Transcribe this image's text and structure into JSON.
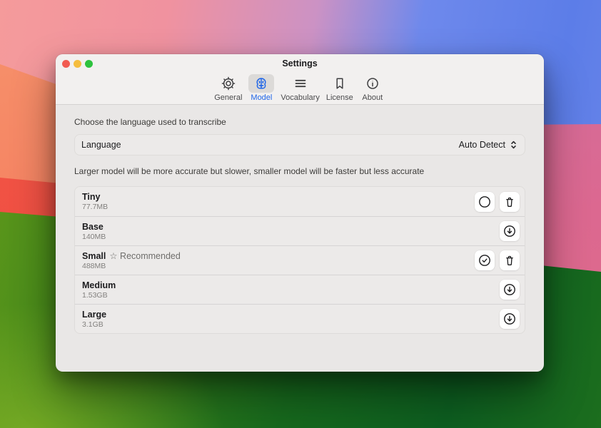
{
  "window": {
    "title": "Settings"
  },
  "traffic_lights": {
    "close": "#f15b51",
    "minimize": "#f5bd3e",
    "zoom": "#2ec23e"
  },
  "toolbar": {
    "accent": "#2167e8",
    "items": [
      {
        "label": "General"
      },
      {
        "label": "Model"
      },
      {
        "label": "Vocabulary"
      },
      {
        "label": "License"
      },
      {
        "label": "About"
      }
    ],
    "selected": "Model"
  },
  "language_section": {
    "description": "Choose the language used to transcribe",
    "label": "Language",
    "value": "Auto Detect"
  },
  "model_section": {
    "description": "Larger model will be more accurate but slower, smaller model will be faster but less accurate",
    "models": [
      {
        "name": "Tiny",
        "size": "77.7MB",
        "badge": ""
      },
      {
        "name": "Base",
        "size": "140MB",
        "badge": ""
      },
      {
        "name": "Small",
        "size": "488MB",
        "badge": "☆ Recommended"
      },
      {
        "name": "Medium",
        "size": "1.53GB",
        "badge": ""
      },
      {
        "name": "Large",
        "size": "3.1GB",
        "badge": ""
      }
    ]
  }
}
